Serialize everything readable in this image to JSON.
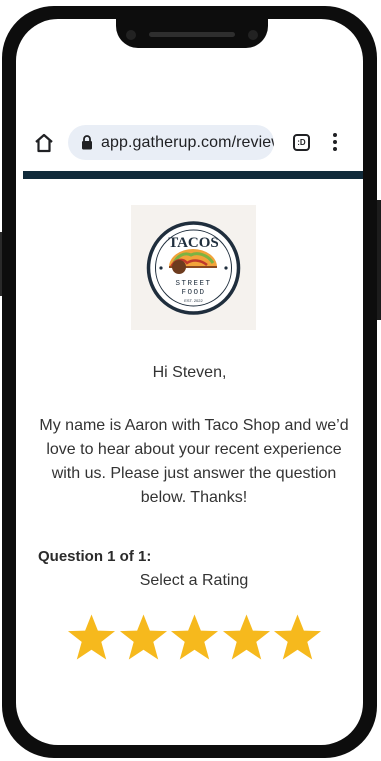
{
  "browser": {
    "url": "app.gatherup.com/review",
    "tabs_label": ":D"
  },
  "logo": {
    "brand_top": "TACOS",
    "brand_mid": "STREET",
    "brand_bottom": "FOOD",
    "est": "EST. 2022"
  },
  "content": {
    "greeting": "Hi Steven,",
    "intro": "My name is Aaron with Taco Shop and we’d love to hear about your recent experience with us. Please just answer the question below. Thanks!",
    "question_label": "Question 1 of 1:",
    "select_rating": "Select a Rating"
  },
  "rating": {
    "max": 5,
    "star_color": "#f6b91d"
  },
  "colors": {
    "accent_bar": "#102a3a",
    "url_pill": "#e9eef6"
  },
  "icons": [
    "home-icon",
    "lock-icon",
    "tabs-icon",
    "more-vert-icon",
    "star-icon"
  ]
}
